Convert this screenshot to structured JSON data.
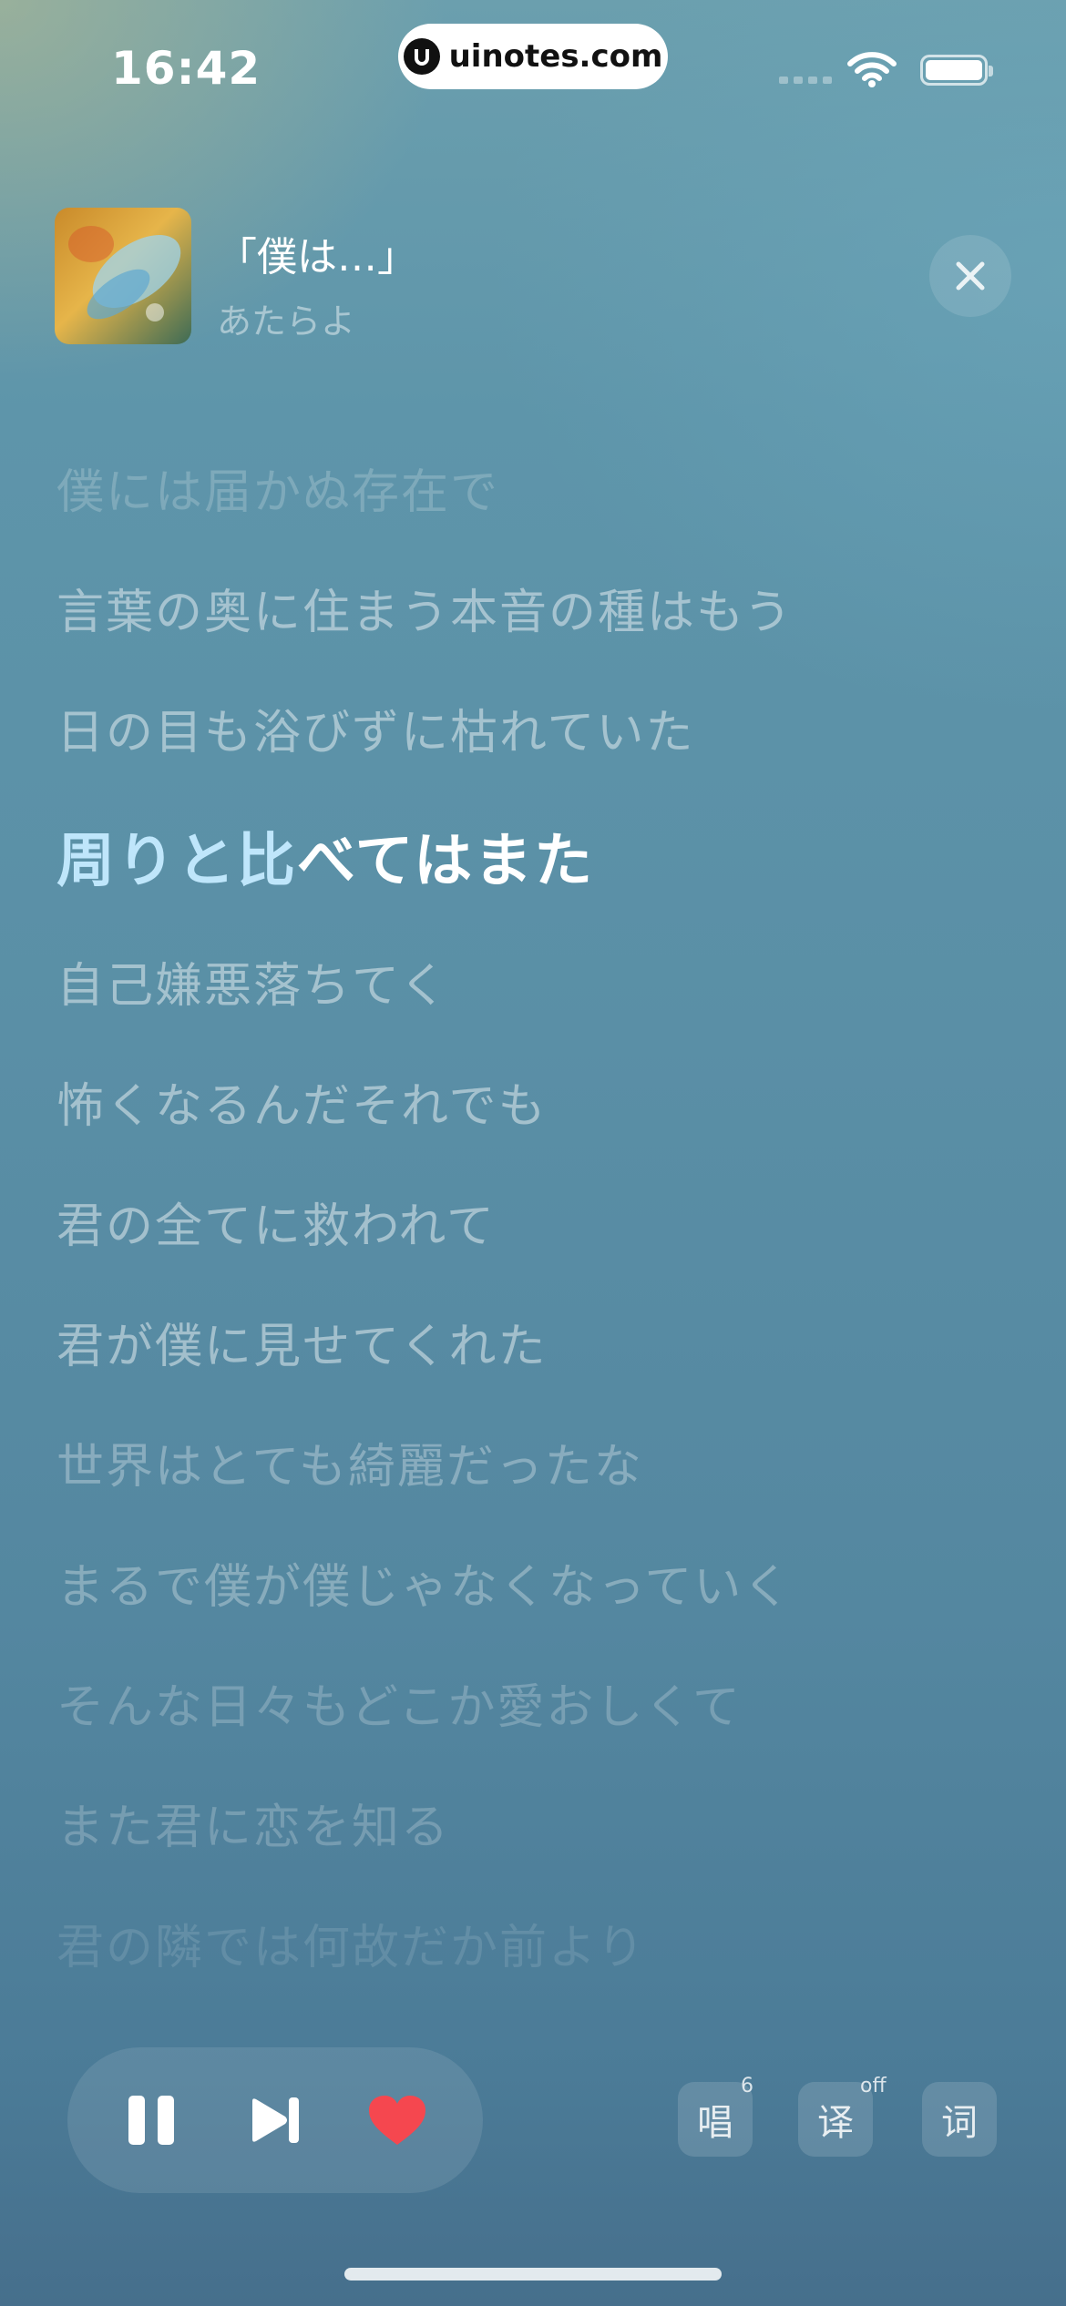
{
  "status_bar": {
    "time": "16:42",
    "watermark": "uinotes.com"
  },
  "now_playing": {
    "title": "「僕は…」",
    "artist": "あたらよ",
    "close_icon": "close-icon"
  },
  "lyrics": {
    "previous": [
      "僕には届かぬ存在で",
      "言葉の奥に住まう本音の種はもう",
      "日の目も浴びずに枯れていた"
    ],
    "current_sung": "周りと比",
    "current_unsung": "べてはまた",
    "upcoming": [
      "自己嫌悪落ちてく",
      "怖くなるんだそれでも",
      "君の全てに救われて",
      "君が僕に見せてくれた",
      "世界はとても綺麗だったな",
      "まるで僕が僕じゃなくなっていく",
      "そんな日々もどこか愛おしくて",
      "また君に恋を知る",
      "君の隣では何故だか前より"
    ]
  },
  "controls": {
    "pause_icon": "pause-icon",
    "next_icon": "next-track-icon",
    "heart_icon": "heart-icon",
    "heart_color": "#f5474f"
  },
  "side_buttons": {
    "sing_label": "唱",
    "sing_count": "6",
    "translate_label": "译",
    "translate_state": "off",
    "lyrics_label": "词"
  }
}
